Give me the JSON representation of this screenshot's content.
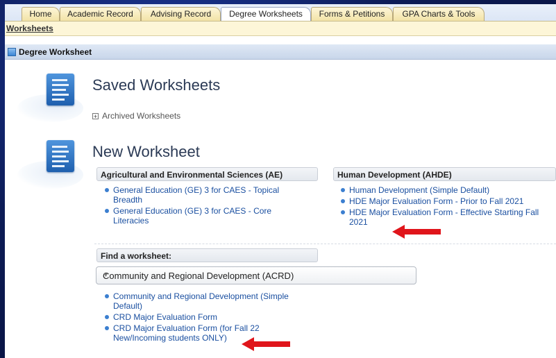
{
  "tabs": [
    "Home",
    "Academic Record",
    "Advising Record",
    "Degree Worksheets",
    "Forms & Petitions",
    "GPA Charts & Tools"
  ],
  "active_tab": "Degree Worksheets",
  "subnav": {
    "link": "Worksheets"
  },
  "panel": {
    "title": "Degree Worksheet"
  },
  "saved": {
    "heading": "Saved Worksheets",
    "archived_label": "Archived Worksheets",
    "expand_glyph": "+"
  },
  "new_ws": {
    "heading": "New Worksheet",
    "groups": [
      {
        "title": "Agricultural and Environmental Sciences (AE)",
        "items": [
          "General Education (GE) 3 for CAES - Topical Breadth",
          "General Education (GE) 3 for CAES - Core Literacies"
        ]
      },
      {
        "title": "Human Development (AHDE)",
        "items": [
          "Human Development (Simple Default)",
          "HDE Major Evaluation Form - Prior to Fall 2021",
          "HDE Major Evaluation Form - Effective Starting Fall 2021"
        ]
      }
    ]
  },
  "find": {
    "label": "Find a worksheet:",
    "selected": "Community and Regional Development (ACRD)",
    "caret": "▼",
    "results": [
      "Community and Regional Development (Simple Default)",
      "CRD Major Evaluation Form",
      "CRD Major Evaluation Form (for Fall 22 New/Incoming students ONLY)"
    ]
  },
  "colors": {
    "accent_red": "#e0151b",
    "link_blue": "#1a4fa0",
    "tab_fill": "#f2e3a6",
    "frame_bg": "#0e1f5c"
  }
}
